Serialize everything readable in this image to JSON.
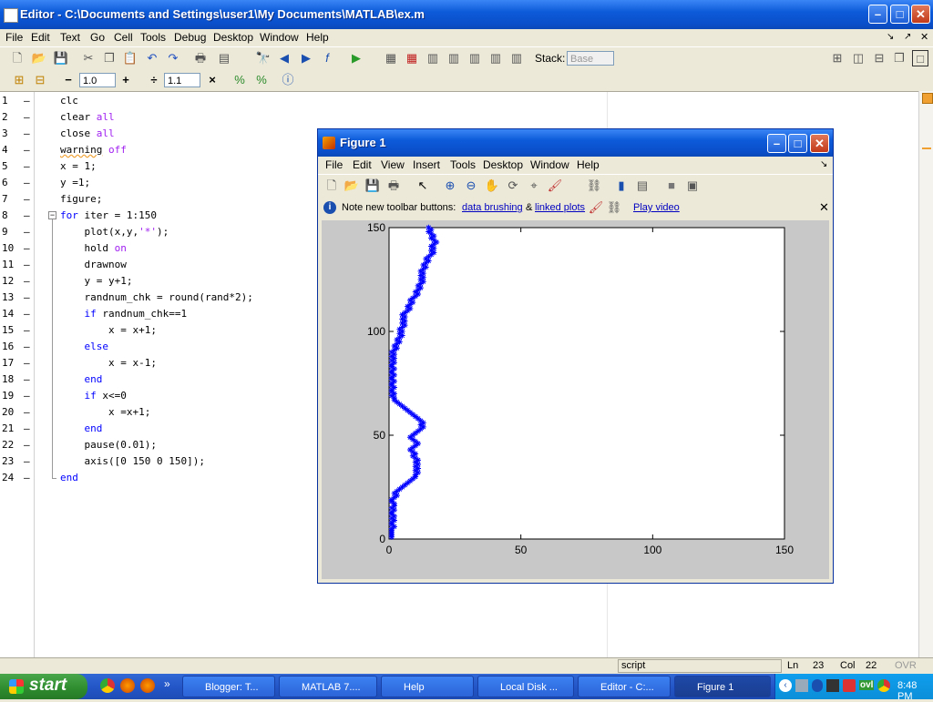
{
  "editor": {
    "title": "Editor - C:\\Documents and Settings\\user1\\My Documents\\MATLAB\\ex.m",
    "menu": [
      "File",
      "Edit",
      "Text",
      "Go",
      "Cell",
      "Tools",
      "Debug",
      "Desktop",
      "Window",
      "Help"
    ],
    "toolbar": {
      "stack_label": "Stack:",
      "stack_value": "Base"
    },
    "cell_toolbar": {
      "minus": "−",
      "plus": "+",
      "value1": "1.0",
      "divide": "÷",
      "value2": "1.1",
      "times": "×"
    },
    "lines": [
      {
        "n": "1",
        "code": "clc"
      },
      {
        "n": "2",
        "code": "clear all"
      },
      {
        "n": "3",
        "code": "close all"
      },
      {
        "n": "4",
        "code": "warning off"
      },
      {
        "n": "5",
        "code": "x = 1;"
      },
      {
        "n": "6",
        "code": "y =1;"
      },
      {
        "n": "7",
        "code": "figure;"
      },
      {
        "n": "8",
        "code": "for iter = 1:150"
      },
      {
        "n": "9",
        "code": "    plot(x,y,'*');"
      },
      {
        "n": "10",
        "code": "    hold on"
      },
      {
        "n": "11",
        "code": "    drawnow"
      },
      {
        "n": "12",
        "code": "    y = y+1;"
      },
      {
        "n": "13",
        "code": "    randnum_chk = round(rand*2);"
      },
      {
        "n": "14",
        "code": "    if randnum_chk==1"
      },
      {
        "n": "15",
        "code": "        x = x+1;"
      },
      {
        "n": "16",
        "code": "    else"
      },
      {
        "n": "17",
        "code": "        x = x-1;"
      },
      {
        "n": "18",
        "code": "    end"
      },
      {
        "n": "19",
        "code": "    if x<=0"
      },
      {
        "n": "20",
        "code": "        x =x+1;"
      },
      {
        "n": "21",
        "code": "    end"
      },
      {
        "n": "22",
        "code": "    pause(0.01);"
      },
      {
        "n": "23",
        "code": "    axis([0 150 0 150]);"
      },
      {
        "n": "24",
        "code": "end"
      }
    ],
    "status": {
      "mode": "script",
      "ln_label": "Ln",
      "ln": "23",
      "col_label": "Col",
      "col": "22",
      "ovr": "OVR"
    }
  },
  "figure": {
    "title": "Figure 1",
    "menu": [
      "File",
      "Edit",
      "View",
      "Insert",
      "Tools",
      "Desktop",
      "Window",
      "Help"
    ],
    "note": {
      "prefix": "Note new toolbar buttons:",
      "link1": "data brushing",
      "amp": "&",
      "link2": "linked plots",
      "video": "Play video"
    },
    "chart_data": {
      "type": "scatter",
      "marker": "*",
      "color": "#0000ff",
      "xlim": [
        0,
        150
      ],
      "ylim": [
        0,
        150
      ],
      "xticks": [
        "0",
        "50",
        "100",
        "150"
      ],
      "yticks": [
        "0",
        "50",
        "100",
        "150"
      ],
      "x": [
        1,
        1,
        1,
        1,
        1,
        2,
        1,
        1,
        2,
        1,
        2,
        1,
        1,
        2,
        1,
        2,
        2,
        1,
        1,
        2,
        3,
        2,
        3,
        4,
        5,
        6,
        7,
        8,
        9,
        10,
        10,
        11,
        10,
        11,
        10,
        11,
        10,
        11,
        10,
        9,
        10,
        9,
        8,
        9,
        10,
        11,
        10,
        9,
        8,
        9,
        10,
        11,
        12,
        13,
        12,
        13,
        12,
        11,
        10,
        9,
        8,
        7,
        6,
        5,
        4,
        3,
        2,
        2,
        1,
        2,
        1,
        1,
        2,
        1,
        1,
        2,
        1,
        1,
        2,
        1,
        1,
        2,
        1,
        1,
        2,
        1,
        2,
        1,
        2,
        1,
        2,
        3,
        2,
        3,
        4,
        3,
        4,
        5,
        4,
        5,
        4,
        5,
        6,
        5,
        6,
        5,
        6,
        5,
        6,
        7,
        8,
        7,
        8,
        9,
        8,
        9,
        10,
        11,
        10,
        11,
        12,
        11,
        12,
        13,
        12,
        13,
        12,
        13,
        12,
        13,
        14,
        13,
        14,
        15,
        14,
        15,
        16,
        17,
        16,
        17,
        16,
        17,
        18,
        17,
        16,
        17,
        16,
        15,
        16,
        15
      ],
      "y": [
        1,
        2,
        3,
        4,
        5,
        6,
        7,
        8,
        9,
        10,
        11,
        12,
        13,
        14,
        15,
        16,
        17,
        18,
        19,
        20,
        21,
        22,
        23,
        24,
        25,
        26,
        27,
        28,
        29,
        30,
        31,
        32,
        33,
        34,
        35,
        36,
        37,
        38,
        39,
        40,
        41,
        42,
        43,
        44,
        45,
        46,
        47,
        48,
        49,
        50,
        51,
        52,
        53,
        54,
        55,
        56,
        57,
        58,
        59,
        60,
        61,
        62,
        63,
        64,
        65,
        66,
        67,
        68,
        69,
        70,
        71,
        72,
        73,
        74,
        75,
        76,
        77,
        78,
        79,
        80,
        81,
        82,
        83,
        84,
        85,
        86,
        87,
        88,
        89,
        90,
        91,
        92,
        93,
        94,
        95,
        96,
        97,
        98,
        99,
        100,
        101,
        102,
        103,
        104,
        105,
        106,
        107,
        108,
        109,
        110,
        111,
        112,
        113,
        114,
        115,
        116,
        117,
        118,
        119,
        120,
        121,
        122,
        123,
        124,
        125,
        126,
        127,
        128,
        129,
        130,
        131,
        132,
        133,
        134,
        135,
        136,
        137,
        138,
        139,
        140,
        141,
        142,
        143,
        144,
        145,
        146,
        147,
        148,
        149,
        150
      ]
    }
  },
  "taskbar": {
    "start": "start",
    "tasks": [
      "Blogger: T...",
      "MATLAB 7....",
      "Help",
      "Local Disk ...",
      "Editor - C:...",
      "Figure 1"
    ],
    "clock": "8:48 PM",
    "tray_text": "ovl"
  },
  "colors": {
    "titlebar": "#0a4fcb",
    "taskbar": "#2456c8",
    "start": "#2e8b2e",
    "keyword": "#0000ff",
    "string": "#a020f0",
    "marker": "#0000ff"
  }
}
